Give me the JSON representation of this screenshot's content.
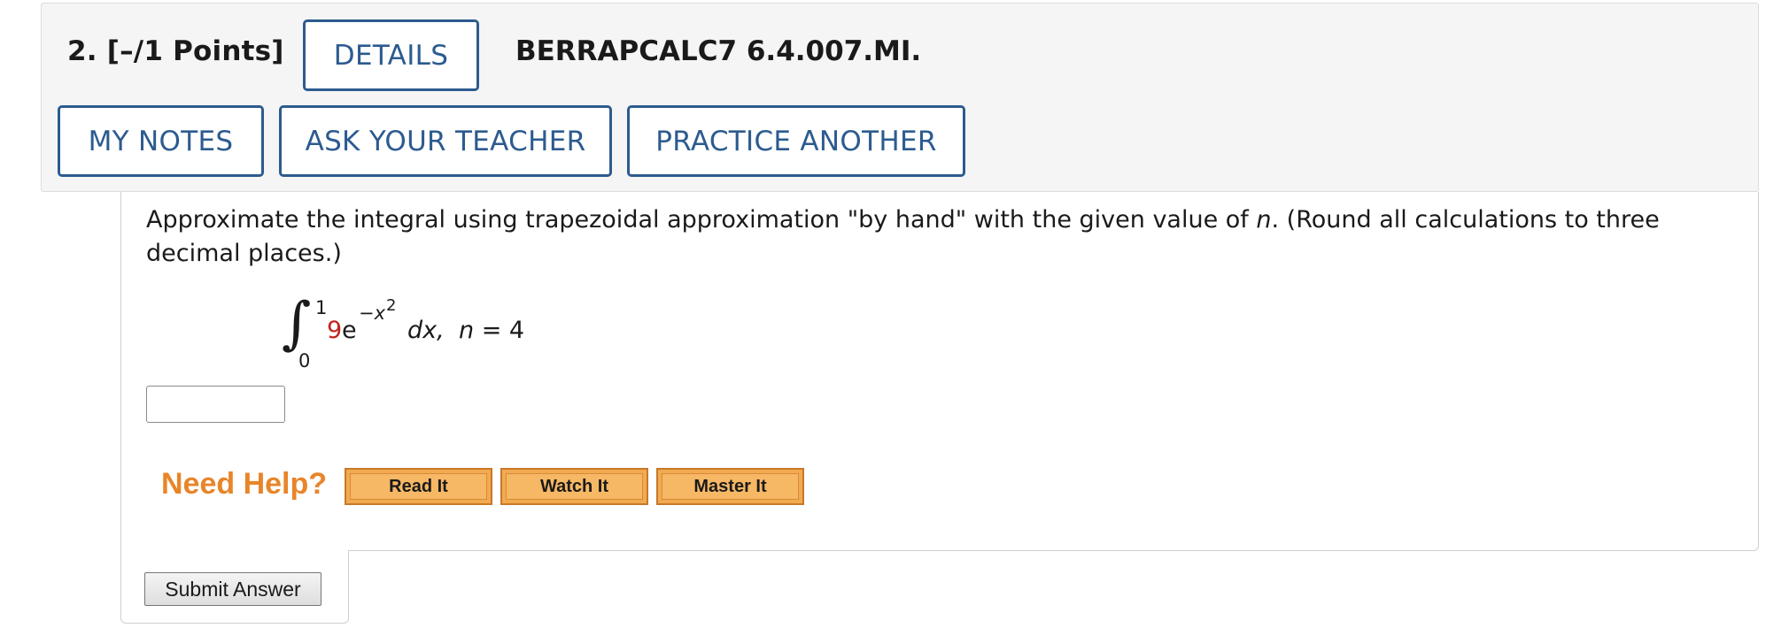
{
  "header": {
    "question_label": "2.  [–/1 Points]",
    "question_id": "BERRAPCALC7 6.4.007.MI.",
    "details_label": "DETAILS",
    "my_notes_label": "MY NOTES",
    "ask_teacher_label": "ASK YOUR TEACHER",
    "practice_another_label": "PRACTICE ANOTHER"
  },
  "question": {
    "prompt_before_n": "Approximate the integral using trapezoidal approximation \"by hand\" with the given value of ",
    "prompt_n": "n",
    "prompt_after_n": ". (Round all calculations to three decimal places.)",
    "integral": {
      "upper_limit": "1",
      "lower_limit": "0",
      "coefficient": "9",
      "base": "e",
      "exponent": "−x",
      "exponent_power": "2",
      "differential": "dx,",
      "n_var": "n",
      "n_value": " = 4"
    },
    "answer_value": ""
  },
  "help": {
    "label": "Need Help?",
    "read_it": "Read It",
    "watch_it": "Watch It",
    "master_it": "Master It"
  },
  "submit": {
    "label": "Submit Answer"
  },
  "colors": {
    "accent": "#2c5b8f",
    "coefficient": "#c0241c",
    "need_help": "#e8852a",
    "help_button": "#f2aa4f"
  }
}
